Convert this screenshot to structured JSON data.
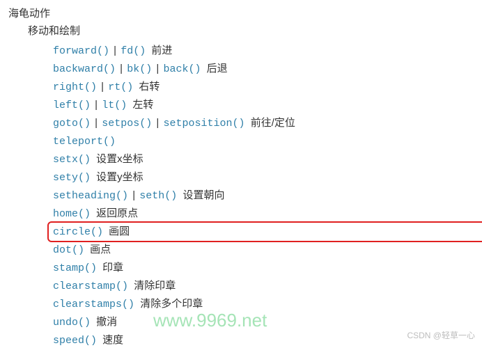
{
  "heading1": "海龟动作",
  "heading2": "移动和绘制",
  "separator": "|",
  "items": [
    {
      "fns": [
        "forward()",
        "fd()"
      ],
      "desc": "前进"
    },
    {
      "fns": [
        "backward()",
        "bk()",
        "back()"
      ],
      "desc": "后退"
    },
    {
      "fns": [
        "right()",
        "rt()"
      ],
      "desc": "右转"
    },
    {
      "fns": [
        "left()",
        "lt()"
      ],
      "desc": "左转"
    },
    {
      "fns": [
        "goto()",
        "setpos()",
        "setposition()"
      ],
      "desc": "前往/定位"
    },
    {
      "fns": [
        "teleport()"
      ],
      "desc": ""
    },
    {
      "fns": [
        "setx()"
      ],
      "desc": "设置x坐标"
    },
    {
      "fns": [
        "sety()"
      ],
      "desc": "设置y坐标"
    },
    {
      "fns": [
        "setheading()",
        "seth()"
      ],
      "desc": "设置朝向"
    },
    {
      "fns": [
        "home()"
      ],
      "desc": "返回原点"
    },
    {
      "fns": [
        "circle()"
      ],
      "desc": "画圆",
      "highlight": true
    },
    {
      "fns": [
        "dot()"
      ],
      "desc": "画点"
    },
    {
      "fns": [
        "stamp()"
      ],
      "desc": "印章"
    },
    {
      "fns": [
        "clearstamp()"
      ],
      "desc": "清除印章"
    },
    {
      "fns": [
        "clearstamps()"
      ],
      "desc": "清除多个印章"
    },
    {
      "fns": [
        "undo()"
      ],
      "desc": "撤消"
    },
    {
      "fns": [
        "speed()"
      ],
      "desc": "速度"
    }
  ],
  "watermark_green": "www.9969.net",
  "watermark_gray": "CSDN @轻草一心",
  "annotation": {
    "highlight_color": "#e02020",
    "arrow_color": "#e02020"
  }
}
